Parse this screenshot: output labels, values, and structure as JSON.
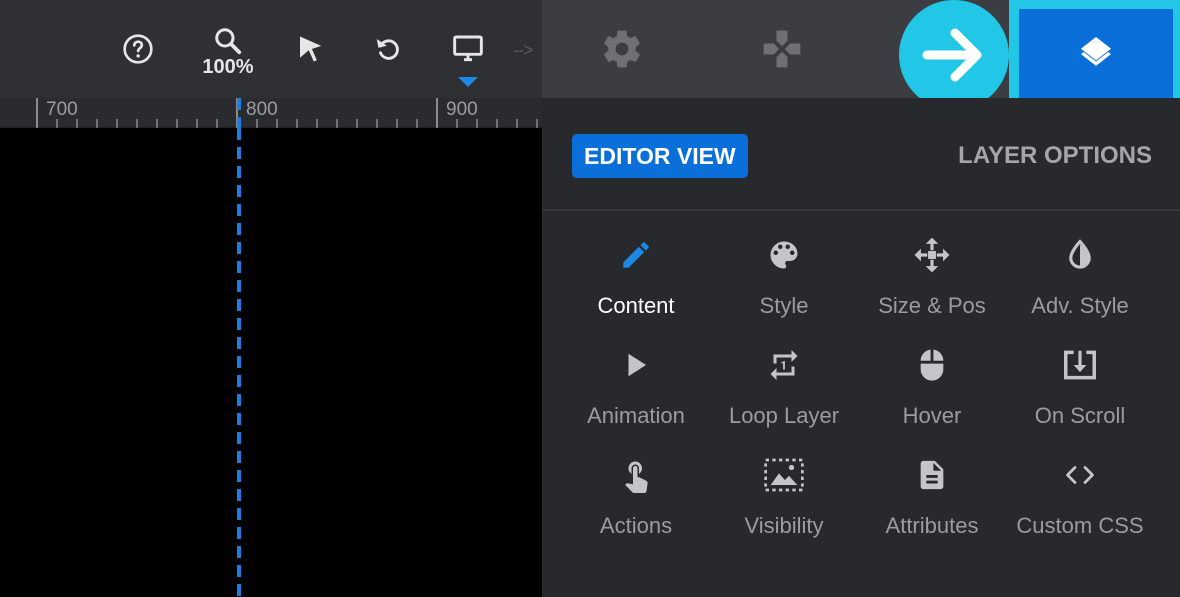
{
  "toolbar": {
    "zoom_level": "100%",
    "arrow_hint": "-->"
  },
  "ruler": {
    "labels": [
      "700",
      "800",
      "900"
    ]
  },
  "panel": {
    "editor_view_label": "EDITOR VIEW",
    "layer_options_label": "LAYER OPTIONS"
  },
  "options": [
    {
      "label": "Content",
      "icon": "pencil-icon",
      "active": true
    },
    {
      "label": "Style",
      "icon": "palette-icon"
    },
    {
      "label": "Size & Pos",
      "icon": "move-icon"
    },
    {
      "label": "Adv. Style",
      "icon": "drop-icon"
    },
    {
      "label": "Animation",
      "icon": "play-icon"
    },
    {
      "label": "Loop Layer",
      "icon": "repeat-icon"
    },
    {
      "label": "Hover",
      "icon": "mouse-icon"
    },
    {
      "label": "On Scroll",
      "icon": "scroll-download-icon"
    },
    {
      "label": "Actions",
      "icon": "touch-icon"
    },
    {
      "label": "Visibility",
      "icon": "image-frame-icon"
    },
    {
      "label": "Attributes",
      "icon": "document-icon"
    },
    {
      "label": "Custom CSS",
      "icon": "code-icon"
    }
  ],
  "colors": {
    "accent": "#0b6fd9",
    "highlight": "#22c7e8",
    "guide": "#1e7ee0"
  }
}
